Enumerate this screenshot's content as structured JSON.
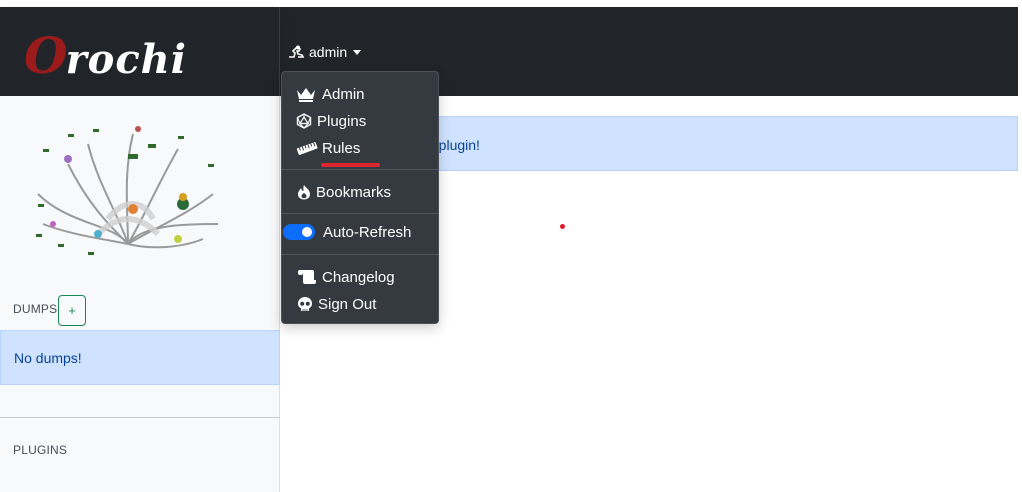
{
  "brand": {
    "logo_first": "O",
    "logo_rest": "rochi"
  },
  "user_menu": {
    "username": "admin",
    "items": [
      {
        "label": "Admin",
        "icon": "crown-icon"
      },
      {
        "label": "Plugins",
        "icon": "dice-d20-icon"
      },
      {
        "label": "Rules",
        "icon": "ruler-icon"
      },
      {
        "label": "Bookmarks",
        "icon": "fire-icon"
      },
      {
        "label": "Auto-Refresh",
        "icon": "toggle-switch",
        "enabled": true
      },
      {
        "label": "Changelog",
        "icon": "scroll-icon"
      },
      {
        "label": "Sign Out",
        "icon": "skull-icon"
      }
    ]
  },
  "sidebar": {
    "dumps_title": "DUMPS",
    "add_label": "+",
    "no_dumps": "No dumps!",
    "plugins_title": "PLUGINS"
  },
  "main": {
    "alert_visible_text": "d plugin!"
  },
  "colors": {
    "navbar": "#212529",
    "dropdown": "#343a40",
    "info_alert": "#cfe2ff",
    "accent_red": "#dc2630",
    "toggle_blue": "#0d6efd",
    "add_green": "#198754"
  }
}
